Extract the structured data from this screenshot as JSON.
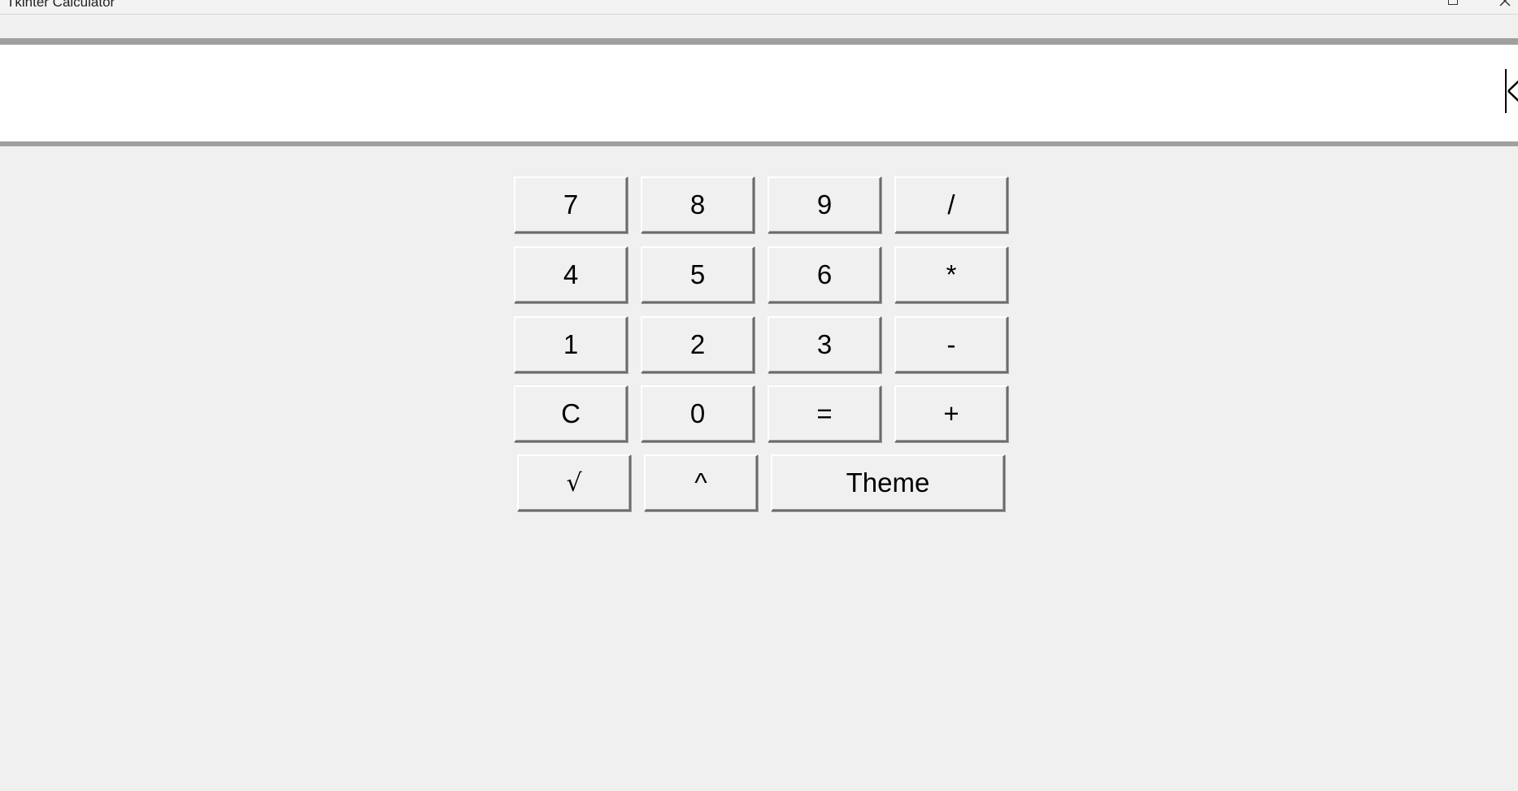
{
  "window": {
    "title": "Tkinter Calculator"
  },
  "display": {
    "value": ""
  },
  "keypad": {
    "rows": [
      [
        "7",
        "8",
        "9",
        "/"
      ],
      [
        "4",
        "5",
        "6",
        "*"
      ],
      [
        "1",
        "2",
        "3",
        "-"
      ],
      [
        "C",
        "0",
        "=",
        "+"
      ]
    ],
    "extra": {
      "sqrt": "√",
      "power": "^",
      "theme": "Theme"
    }
  },
  "icons": {
    "restore": "restore-icon",
    "close": "close-icon"
  },
  "colors": {
    "background": "#f0f0f0",
    "display_bg": "#ffffff",
    "display_border": "#a0a0a0"
  }
}
